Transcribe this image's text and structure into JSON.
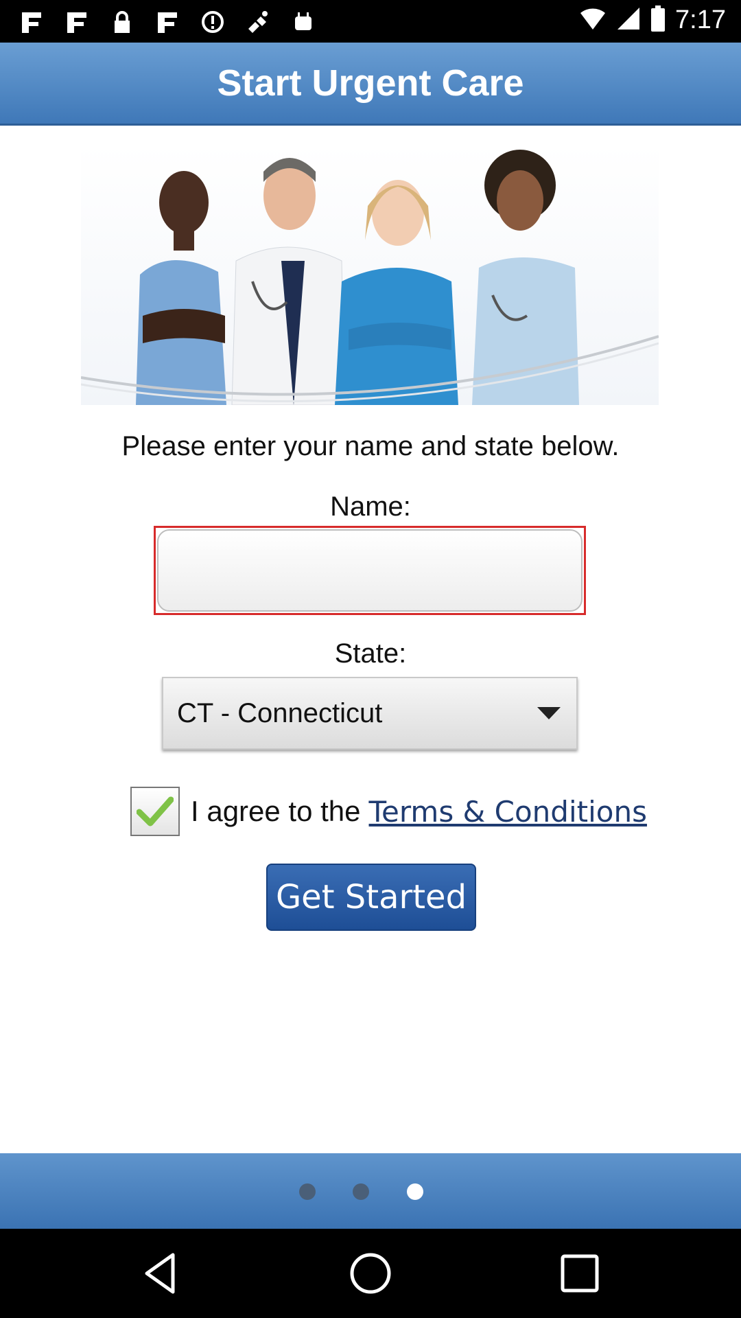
{
  "status_bar": {
    "time": "7:17"
  },
  "title": "Start Urgent Care",
  "instruction": "Please enter your name and state below.",
  "form": {
    "name_label": "Name:",
    "name_value": "",
    "state_label": "State:",
    "state_value": "CT - Connecticut"
  },
  "agree": {
    "checked": true,
    "text": "I agree to the",
    "link": "Terms & Conditions"
  },
  "cta": "Get Started",
  "pager": {
    "pages": 3,
    "current": 3
  },
  "colors": {
    "accent": "#3f78b8",
    "error_border": "#d72b2b",
    "check": "#7fc247"
  }
}
